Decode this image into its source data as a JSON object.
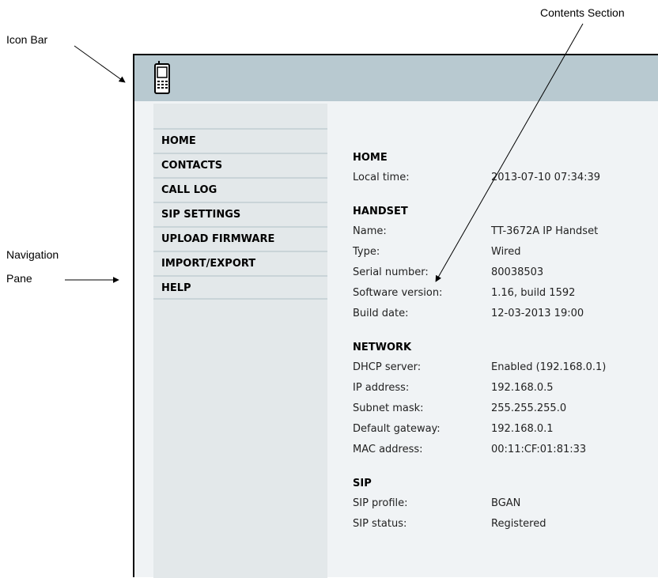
{
  "callouts": {
    "icon_bar": "Icon Bar",
    "contents_section": "Contents Section",
    "navigation_line1": "Navigation",
    "navigation_line2": "Pane"
  },
  "icon_bar": {
    "icon": "phone-handset-icon"
  },
  "nav": {
    "items": [
      {
        "label": "HOME"
      },
      {
        "label": "CONTACTS"
      },
      {
        "label": "CALL LOG"
      },
      {
        "label": "SIP SETTINGS"
      },
      {
        "label": "UPLOAD FIRMWARE"
      },
      {
        "label": "IMPORT/EXPORT"
      },
      {
        "label": "HELP"
      }
    ]
  },
  "content": {
    "sections": [
      {
        "title": "HOME",
        "rows": [
          {
            "label": "Local time:",
            "value": "2013-07-10 07:34:39"
          }
        ]
      },
      {
        "title": "HANDSET",
        "rows": [
          {
            "label": "Name:",
            "value": "TT-3672A IP Handset"
          },
          {
            "label": "Type:",
            "value": "Wired"
          },
          {
            "label": "Serial number:",
            "value": "80038503"
          },
          {
            "label": "Software version:",
            "value": "1.16, build 1592"
          },
          {
            "label": "Build date:",
            "value": "12-03-2013 19:00"
          }
        ]
      },
      {
        "title": "NETWORK",
        "rows": [
          {
            "label": "DHCP server:",
            "value": "Enabled (192.168.0.1)"
          },
          {
            "label": "IP address:",
            "value": "192.168.0.5"
          },
          {
            "label": "Subnet mask:",
            "value": "255.255.255.0"
          },
          {
            "label": "Default gateway:",
            "value": "192.168.0.1"
          },
          {
            "label": "MAC address:",
            "value": "00:11:CF:01:81:33"
          }
        ]
      },
      {
        "title": "SIP",
        "rows": [
          {
            "label": "SIP profile:",
            "value": "BGAN"
          },
          {
            "label": "SIP status:",
            "value": "Registered"
          }
        ]
      }
    ]
  }
}
